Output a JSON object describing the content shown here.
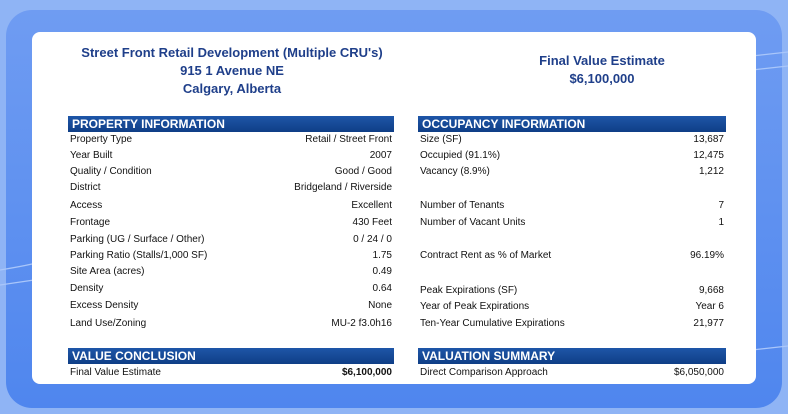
{
  "header": {
    "title_lines": [
      "Street Front Retail Development (Multiple CRU's)",
      "915 1 Avenue NE",
      "Calgary, Alberta"
    ],
    "estimate_label": "Final Value Estimate",
    "estimate_value": "$6,100,000"
  },
  "property_information": {
    "heading": "PROPERTY INFORMATION",
    "rows": [
      {
        "label": "Property Type",
        "value": "Retail / Street Front"
      },
      {
        "label": "Year Built",
        "value": "2007"
      },
      {
        "label": "Quality / Condition",
        "value": "Good / Good"
      },
      {
        "label": "District",
        "value": "Bridgeland / Riverside"
      },
      {
        "label": "Access",
        "value": "Excellent"
      },
      {
        "label": "Frontage",
        "value": "430 Feet"
      },
      {
        "label": "Parking (UG / Surface / Other)",
        "value": "0 / 24 / 0"
      },
      {
        "label": "Parking Ratio (Stalls/1,000 SF)",
        "value": "1.75"
      },
      {
        "label": "Site Area (acres)",
        "value": "0.49"
      },
      {
        "label": "Density",
        "value": "0.64"
      },
      {
        "label": "Excess Density",
        "value": "None"
      },
      {
        "label": "Land Use/Zoning",
        "value": "MU-2 f3.0h16"
      }
    ]
  },
  "occupancy_information": {
    "heading": "OCCUPANCY INFORMATION",
    "rows": [
      {
        "label": "Size (SF)",
        "value": "13,687"
      },
      {
        "label": "Occupied (91.1%)",
        "value": "12,475"
      },
      {
        "label": "Vacancy (8.9%)",
        "value": "1,212"
      },
      {
        "label": "Number of Tenants",
        "value": "7"
      },
      {
        "label": "Number of Vacant Units",
        "value": "1"
      },
      {
        "label": "Contract Rent as % of Market",
        "value": "96.19%"
      },
      {
        "label": "Peak Expirations (SF)",
        "value": "9,668"
      },
      {
        "label": "Year of Peak Expirations",
        "value": "Year 6"
      },
      {
        "label": "Ten-Year Cumulative Expirations",
        "value": "21,977"
      }
    ]
  },
  "value_conclusion": {
    "heading": "VALUE CONCLUSION",
    "rows": [
      {
        "label": "Final Value Estimate",
        "value": "$6,100,000"
      }
    ]
  },
  "valuation_summary": {
    "heading": "VALUATION SUMMARY",
    "rows": [
      {
        "label": "Direct Comparison Approach",
        "value": "$6,050,000"
      }
    ]
  },
  "colors": {
    "background": "#8fb4f5",
    "frame": "#4f86ee",
    "section_bar": "#0f3e86",
    "title_text": "#1f3f8a"
  }
}
